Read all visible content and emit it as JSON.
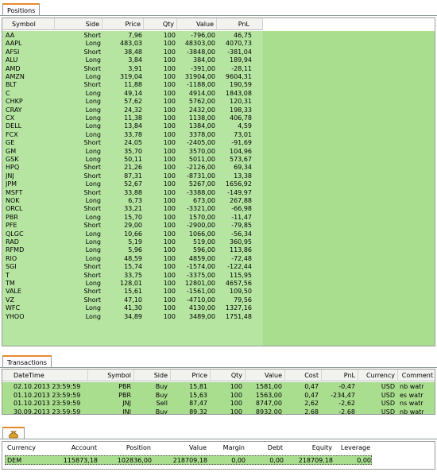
{
  "positions": {
    "tab": "Positions",
    "columns": [
      "Symbol",
      "Side",
      "Price",
      "Qty",
      "Value",
      "PnL"
    ],
    "rows": [
      [
        "AA",
        "Short",
        "7,96",
        "100",
        "-796,00",
        "46,75"
      ],
      [
        "AAPL",
        "Long",
        "483,03",
        "100",
        "48303,00",
        "4070,73"
      ],
      [
        "AFSI",
        "Short",
        "38,48",
        "100",
        "-3848,00",
        "-381,04"
      ],
      [
        "ALU",
        "Long",
        "3,84",
        "100",
        "384,00",
        "189,94"
      ],
      [
        "AMD",
        "Short",
        "3,91",
        "100",
        "-391,00",
        "-28,11"
      ],
      [
        "AMZN",
        "Long",
        "319,04",
        "100",
        "31904,00",
        "9604,31"
      ],
      [
        "BLT",
        "Short",
        "11,88",
        "100",
        "-1188,00",
        "190,59"
      ],
      [
        "C",
        "Long",
        "49,14",
        "100",
        "4914,00",
        "1843,08"
      ],
      [
        "CHKP",
        "Long",
        "57,62",
        "100",
        "5762,00",
        "120,31"
      ],
      [
        "CRAY",
        "Long",
        "24,32",
        "100",
        "2432,00",
        "198,33"
      ],
      [
        "CX",
        "Long",
        "11,38",
        "100",
        "1138,00",
        "406,78"
      ],
      [
        "DELL",
        "Long",
        "13,84",
        "100",
        "1384,00",
        "4,59"
      ],
      [
        "FCX",
        "Long",
        "33,78",
        "100",
        "3378,00",
        "73,01"
      ],
      [
        "GE",
        "Short",
        "24,05",
        "100",
        "-2405,00",
        "-91,69"
      ],
      [
        "GM",
        "Long",
        "35,70",
        "100",
        "3570,00",
        "104,96"
      ],
      [
        "GSK",
        "Long",
        "50,11",
        "100",
        "5011,00",
        "573,67"
      ],
      [
        "HPQ",
        "Short",
        "21,26",
        "100",
        "-2126,00",
        "69,34"
      ],
      [
        "JNJ",
        "Short",
        "87,31",
        "100",
        "-8731,00",
        "13,38"
      ],
      [
        "JPM",
        "Long",
        "52,67",
        "100",
        "5267,00",
        "1656,92"
      ],
      [
        "MSFT",
        "Short",
        "33,88",
        "100",
        "-3388,00",
        "-149,97"
      ],
      [
        "NOK",
        "Long",
        "6,73",
        "100",
        "673,00",
        "267,88"
      ],
      [
        "ORCL",
        "Short",
        "33,21",
        "100",
        "-3321,00",
        "-66,98"
      ],
      [
        "PBR",
        "Long",
        "15,70",
        "100",
        "1570,00",
        "-11,47"
      ],
      [
        "PFE",
        "Short",
        "29,00",
        "100",
        "-2900,00",
        "-79,85"
      ],
      [
        "QLGC",
        "Long",
        "10,66",
        "100",
        "1066,00",
        "-56,34"
      ],
      [
        "RAD",
        "Long",
        "5,19",
        "100",
        "519,00",
        "360,95"
      ],
      [
        "RFMD",
        "Long",
        "5,96",
        "100",
        "596,00",
        "113,86"
      ],
      [
        "RIO",
        "Long",
        "48,59",
        "100",
        "4859,00",
        "-72,48"
      ],
      [
        "SGI",
        "Short",
        "15,74",
        "100",
        "-1574,00",
        "-122,44"
      ],
      [
        "T",
        "Short",
        "33,75",
        "100",
        "-3375,00",
        "115,95"
      ],
      [
        "TM",
        "Long",
        "128,01",
        "100",
        "12801,00",
        "4657,56"
      ],
      [
        "VALE",
        "Short",
        "15,61",
        "100",
        "-1561,00",
        "109,50"
      ],
      [
        "VZ",
        "Short",
        "47,10",
        "100",
        "-4710,00",
        "79,56"
      ],
      [
        "WFC",
        "Long",
        "41,30",
        "100",
        "4130,00",
        "1327,16"
      ],
      [
        "YHOO",
        "Long",
        "34,89",
        "100",
        "3489,00",
        "1751,48"
      ]
    ]
  },
  "transactions": {
    "tab": "Transactions",
    "columns": [
      "DateTime",
      "Symbol",
      "Side",
      "Price",
      "Qty",
      "Value",
      "Cost",
      "PnL",
      "Currency",
      "Comment"
    ],
    "rows": [
      [
        "02.10.2013 23:59:59",
        "PBR",
        "Buy",
        "15,81",
        "100",
        "1581,00",
        "0,47",
        "-0,47",
        "USD",
        "nb watr"
      ],
      [
        "01.10.2013 23:59:59",
        "PBR",
        "Buy",
        "15,63",
        "100",
        "1563,00",
        "0,47",
        "-234,47",
        "USD",
        "es watr"
      ],
      [
        "01.10.2013 23:59:59",
        "JNJ",
        "Sell",
        "87,47",
        "100",
        "8747,00",
        "2,62",
        "-2,62",
        "USD",
        "ns watr"
      ],
      [
        "30.09.2013 23:59:59",
        "JNJ",
        "Buy",
        "89,32",
        "100",
        "8932,00",
        "2,68",
        "-2,68",
        "USD",
        "nb watr"
      ]
    ]
  },
  "account": {
    "columns": [
      "Currency",
      "Account",
      "Position",
      "Value",
      "Margin",
      "Debt",
      "Equity",
      "Leverage"
    ],
    "row": [
      "DEM",
      "115873,18",
      "102836,00",
      "218709,18",
      "0,00",
      "0,00",
      "218709,18",
      "0,00"
    ]
  },
  "colors": {
    "row_green": "#a9de8f",
    "tab_accent": "#e68b2c"
  }
}
